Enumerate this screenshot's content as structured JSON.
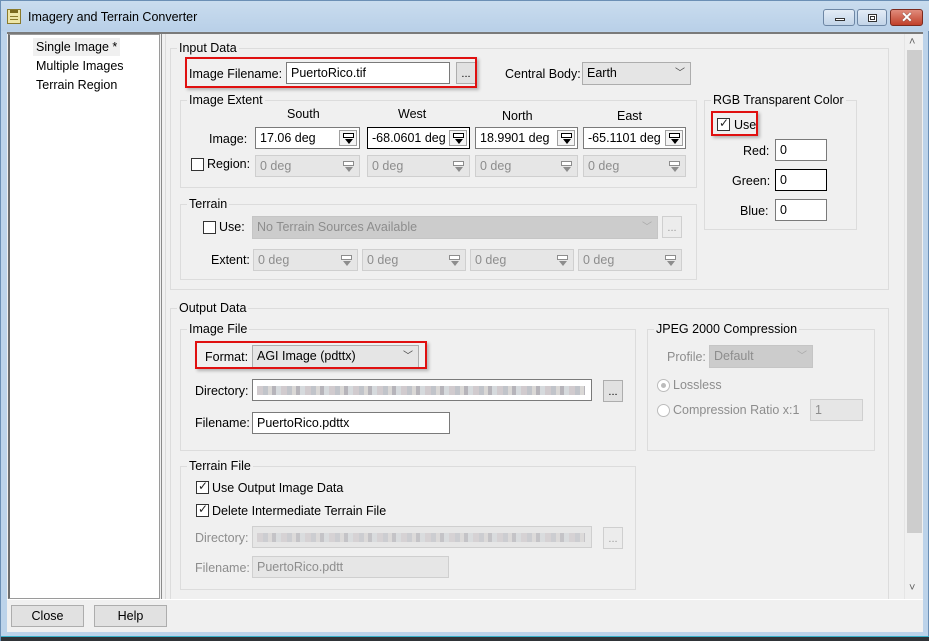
{
  "window": {
    "title": "Imagery and Terrain Converter",
    "controls": {
      "minimize": "minimize",
      "maximize": "maximize",
      "close": "close"
    }
  },
  "nav": {
    "items": [
      {
        "label": "Single Image *",
        "selected": true
      },
      {
        "label": "Multiple Images",
        "selected": false
      },
      {
        "label": "Terrain Region",
        "selected": false
      }
    ]
  },
  "input_data": {
    "title": "Input Data",
    "image_filename_label": "Image Filename:",
    "image_filename_value": "PuertoRico.tif",
    "browse_label": "...",
    "central_body_label": "Central Body:",
    "central_body_value": "Earth",
    "image_extent": {
      "title": "Image Extent",
      "columns": [
        "South",
        "West",
        "North",
        "East"
      ],
      "image_label": "Image:",
      "image_values": [
        "17.06 deg",
        "-68.0601 deg",
        "18.9901 deg",
        "-65.1101 deg"
      ],
      "region_label": "Region:",
      "region_checked": false,
      "region_values": [
        "0 deg",
        "0 deg",
        "0 deg",
        "0 deg"
      ]
    },
    "terrain": {
      "title": "Terrain",
      "use_label": "Use:",
      "use_checked": false,
      "source_value": "No Terrain Sources Available",
      "browse_label": "...",
      "extent_label": "Extent:",
      "extent_values": [
        "0 deg",
        "0 deg",
        "0 deg",
        "0 deg"
      ]
    },
    "rgb_transparent": {
      "title": "RGB Transparent Color",
      "use_label": "Use",
      "use_checked": true,
      "red_label": "Red:",
      "red_value": "0",
      "green_label": "Green:",
      "green_value": "0",
      "blue_label": "Blue:",
      "blue_value": "0"
    }
  },
  "output_data": {
    "title": "Output Data",
    "image_file": {
      "title": "Image File",
      "format_label": "Format:",
      "format_value": "AGI Image (pdttx)",
      "directory_label": "Directory:",
      "browse_label": "...",
      "filename_label": "Filename:",
      "filename_value": "PuertoRico.pdttx"
    },
    "jpeg2000": {
      "title": "JPEG 2000 Compression",
      "profile_label": "Profile:",
      "profile_value": "Default",
      "lossless_label": "Lossless",
      "lossless_selected": true,
      "ratio_label": "Compression Ratio x:1",
      "ratio_value": "1"
    },
    "terrain_file": {
      "title": "Terrain File",
      "use_output_label": "Use Output Image Data",
      "use_output_checked": true,
      "delete_intermediate_label": "Delete Intermediate Terrain File",
      "delete_intermediate_checked": true,
      "directory_label": "Directory:",
      "browse_label": "...",
      "filename_label": "Filename:",
      "filename_value": "PuertoRico.pdtt"
    }
  },
  "footer": {
    "close_label": "Close",
    "help_label": "Help"
  },
  "highlight_color": "#e01010"
}
